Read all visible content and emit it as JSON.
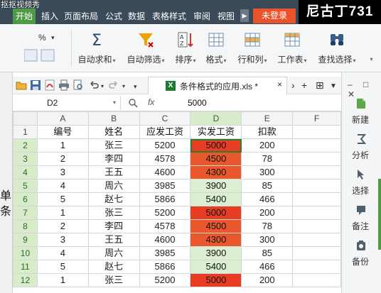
{
  "watermark": "抠抠视频秀",
  "brand_overlay": "尼古丁731",
  "menu": {
    "items": [
      "开始",
      "插入",
      "页面布局",
      "公式",
      "数据",
      "表格样式",
      "审阅",
      "视图"
    ],
    "active_index": 0,
    "login_label": "未登录"
  },
  "ribbon": {
    "left_fragments": [
      "%",
      "▾"
    ],
    "buttons": [
      {
        "label": "自动求和",
        "icon": "sum-icon"
      },
      {
        "label": "自动筛选",
        "icon": "filter-icon"
      },
      {
        "label": "排序",
        "icon": "sort-icon"
      },
      {
        "label": "格式",
        "icon": "format-icon"
      },
      {
        "label": "行和列",
        "icon": "row-col-icon"
      },
      {
        "label": "工作表",
        "icon": "worksheet-icon"
      },
      {
        "label": "查找选择",
        "icon": "find-icon"
      }
    ]
  },
  "left_panel": {
    "fragments": [
      "单",
      "条"
    ]
  },
  "document_tab": {
    "name": "条件格式的应用.xls *",
    "close": "×",
    "add": "+",
    "tile": "⊞"
  },
  "formula_bar": {
    "cell_ref": "D2",
    "fx": "fx",
    "value": "5000"
  },
  "sheet": {
    "columns": [
      "A",
      "B",
      "C",
      "D",
      "E",
      "F"
    ],
    "selected_column": "D",
    "row_numbers": [
      "1",
      "2",
      "3",
      "4",
      "5",
      "6",
      "7",
      "8",
      "9",
      "10",
      "11",
      "12"
    ],
    "header_row": [
      "编号",
      "姓名",
      "应发工资",
      "实发工资",
      "扣款",
      ""
    ],
    "rows": [
      [
        "1",
        "张三",
        "5200",
        "5000",
        "200",
        ""
      ],
      [
        "2",
        "李四",
        "4578",
        "4500",
        "78",
        ""
      ],
      [
        "3",
        "王五",
        "4600",
        "4300",
        "300",
        ""
      ],
      [
        "4",
        "周六",
        "3985",
        "3900",
        "85",
        ""
      ],
      [
        "5",
        "赵七",
        "5866",
        "5400",
        "466",
        ""
      ],
      [
        "1",
        "张三",
        "5200",
        "5000",
        "200",
        ""
      ],
      [
        "2",
        "李四",
        "4578",
        "4500",
        "78",
        ""
      ],
      [
        "3",
        "王五",
        "4600",
        "4300",
        "300",
        ""
      ],
      [
        "4",
        "周六",
        "3985",
        "3900",
        "85",
        ""
      ],
      [
        "5",
        "赵七",
        "5866",
        "5400",
        "466",
        ""
      ],
      [
        "1",
        "张三",
        "5200",
        "5000",
        "200",
        ""
      ]
    ],
    "d_fill": [
      "red",
      "orange",
      "orange",
      "green",
      "green",
      "red",
      "orange",
      "orange",
      "green",
      "green",
      "red"
    ],
    "colors": {
      "red": "#e83d25",
      "orange": "#e9582d",
      "green": "#dcf0d1",
      "selection": "#2e7d32"
    }
  },
  "right_sidebar": {
    "items": [
      {
        "label": "新建",
        "icon": "new-icon"
      },
      {
        "label": "分析",
        "icon": "analysis-icon"
      },
      {
        "label": "选择",
        "icon": "select-icon"
      },
      {
        "label": "备注",
        "icon": "note-icon"
      },
      {
        "label": "备份",
        "icon": "backup-icon"
      }
    ]
  }
}
